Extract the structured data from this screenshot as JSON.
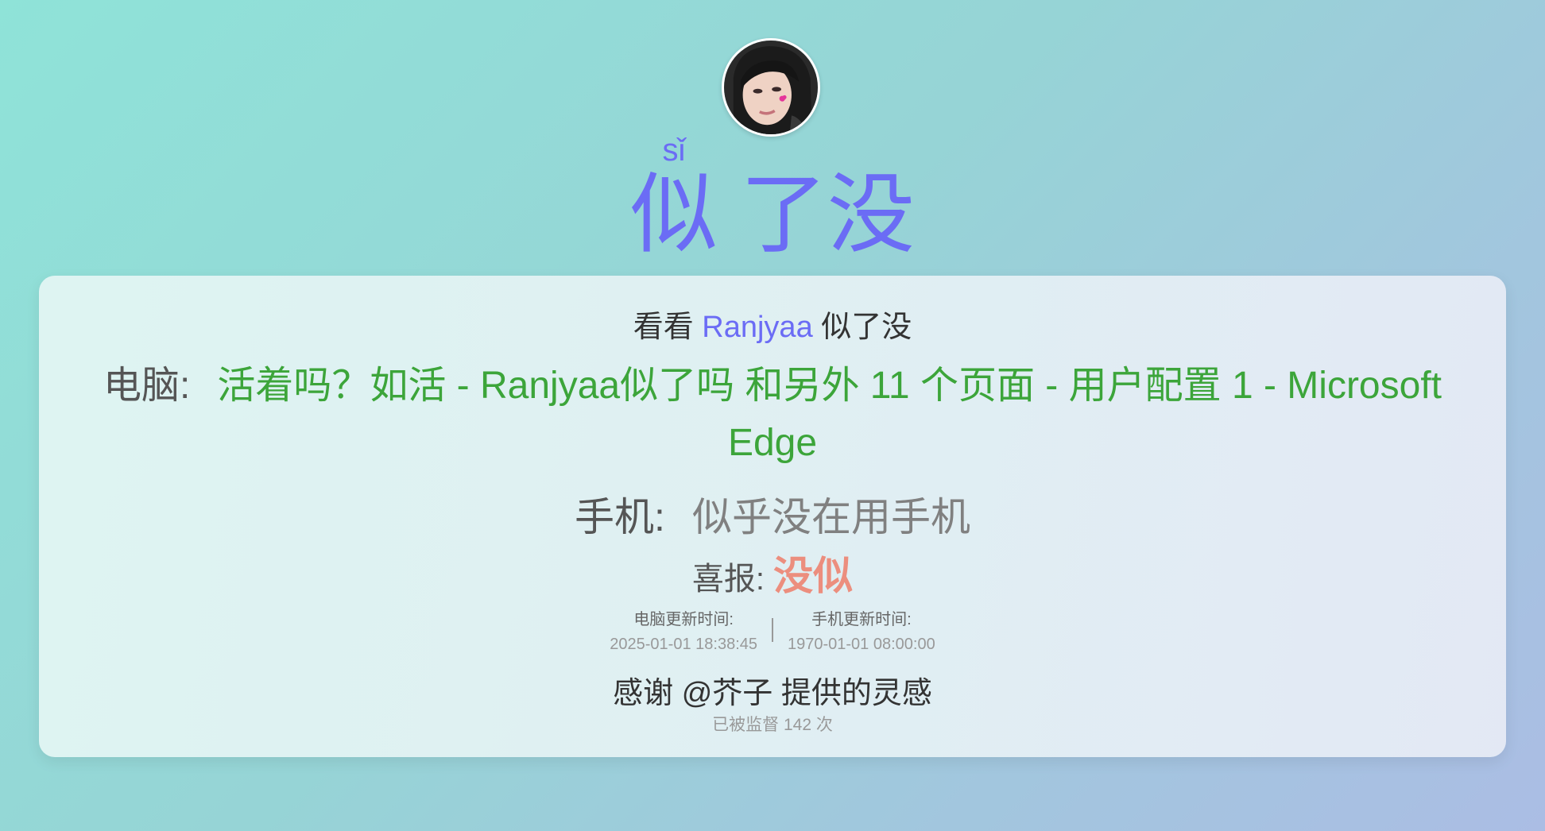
{
  "avatar": {
    "icon": "avatar-photo"
  },
  "title": {
    "char1": "似",
    "char1_pinyin": "sǐ",
    "rest": "了没"
  },
  "view": {
    "prefix": "看看",
    "name": "Ranjyaa",
    "suffix": "似了没"
  },
  "pc": {
    "label": "电脑:",
    "status": "活着吗？如活 - Ranjyaa似了吗 和另外 11 个页面 - 用户配置 1 - Microsoft Edge"
  },
  "phone": {
    "label": "手机:",
    "status": "似乎没在用手机"
  },
  "news": {
    "label": "喜报:",
    "status": "没似"
  },
  "times": {
    "pc_label": "电脑更新时间:",
    "pc_value": "2025-01-01 18:38:45",
    "phone_label": "手机更新时间:",
    "phone_value": "1970-01-01 08:00:00"
  },
  "thanks": "感谢 @芥子 提供的灵感",
  "count": "已被监督 142 次",
  "colors": {
    "accent": "#6b6cf5",
    "status_green": "#3ca53a",
    "news_red": "#ec8e7e",
    "muted": "#999999"
  }
}
